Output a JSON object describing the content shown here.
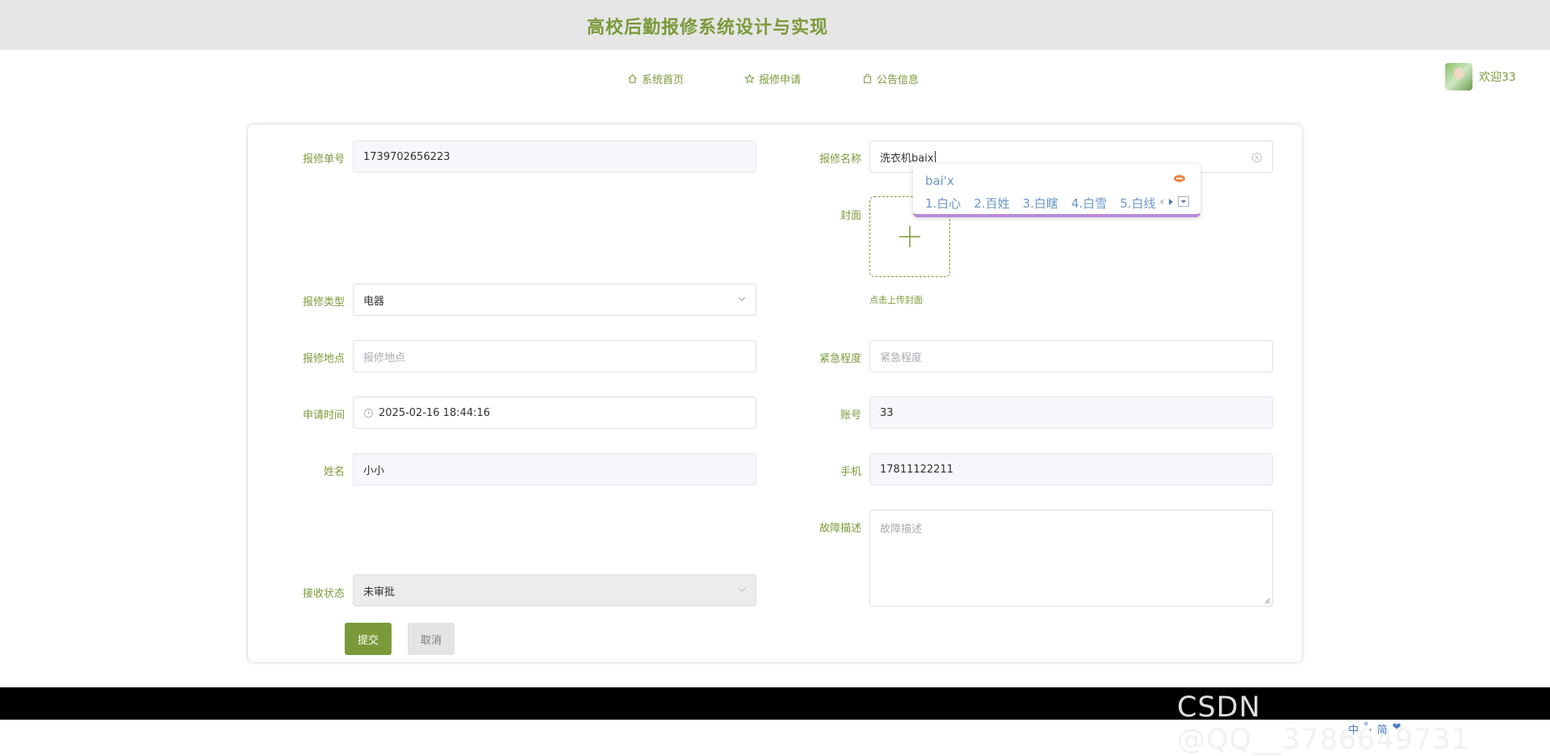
{
  "header": {
    "title": "高校后勤报修系统设计与实现"
  },
  "nav": {
    "items": [
      {
        "label": "系统首页",
        "icon": "home-icon"
      },
      {
        "label": "报修申请",
        "icon": "star-icon"
      },
      {
        "label": "公告信息",
        "icon": "bag-icon"
      }
    ]
  },
  "user": {
    "welcome": "欢迎33"
  },
  "form": {
    "order_no": {
      "label": "报修单号",
      "value": "1739702656223"
    },
    "repair_name": {
      "label": "报修名称",
      "value": "洗衣机baix"
    },
    "cover": {
      "label": "封面",
      "hint": "点击上传封面"
    },
    "repair_type": {
      "label": "报修类型",
      "value": "电器"
    },
    "location": {
      "label": "报修地点",
      "placeholder": "报修地点"
    },
    "urgency": {
      "label": "紧急程度",
      "placeholder": "紧急程度"
    },
    "apply_time": {
      "label": "申请时间",
      "value": "2025-02-16 18:44:16"
    },
    "account": {
      "label": "账号",
      "value": "33"
    },
    "name": {
      "label": "姓名",
      "value": "小小"
    },
    "phone": {
      "label": "手机",
      "value": "17811122211"
    },
    "fault": {
      "label": "故障描述",
      "placeholder": "故障描述"
    },
    "status": {
      "label": "接收状态",
      "value": "未审批"
    },
    "submit_label": "提交",
    "cancel_label": "取消"
  },
  "ime": {
    "composition": "bai'x",
    "candidates": [
      "1.白心",
      "2.百姓",
      "3.白瞎",
      "4.白雪",
      "5.白线"
    ]
  },
  "watermark": "CSDN @QQ__3786649731",
  "ime_status": [
    "中",
    "°,",
    "简",
    "❤"
  ],
  "colors": {
    "accent": "#7a9a3a",
    "topbar": "#e6e6e6",
    "footer": "#000000"
  }
}
